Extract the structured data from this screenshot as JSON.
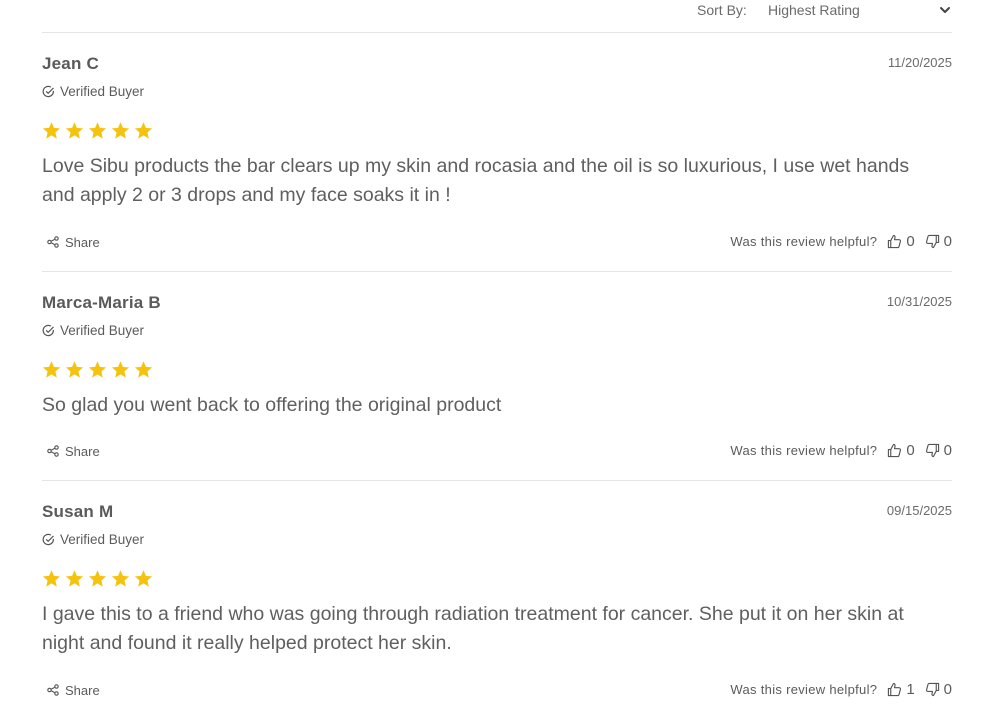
{
  "sort": {
    "label": "Sort By:",
    "value": "Highest Rating"
  },
  "colors": {
    "star": "#f5c30f",
    "text": "#5f5f5f",
    "divider": "#e6e6e6"
  },
  "reviews": [
    {
      "author": "Jean C",
      "date": "11/20/2025",
      "verified": "Verified Buyer",
      "rating": 5,
      "body": "Love Sibu products the bar clears up my skin and rocasia and the oil is so luxurious, I use wet hands and apply 2 or 3 drops and my face soaks it in !",
      "share": "Share",
      "helpful_q": "Was this review helpful?",
      "up": "0",
      "down": "0"
    },
    {
      "author": "Marca-Maria B",
      "date": "10/31/2025",
      "verified": "Verified Buyer",
      "rating": 5,
      "body": "So glad you went back to offering the original product",
      "share": "Share",
      "helpful_q": "Was this review helpful?",
      "up": "0",
      "down": "0"
    },
    {
      "author": "Susan M",
      "date": "09/15/2025",
      "verified": "Verified Buyer",
      "rating": 5,
      "body": "I gave this to a friend who was going through radiation treatment for cancer. She put it on her skin at night and found it really helped protect her skin.",
      "share": "Share",
      "helpful_q": "Was this review helpful?",
      "up": "1",
      "down": "0"
    }
  ]
}
